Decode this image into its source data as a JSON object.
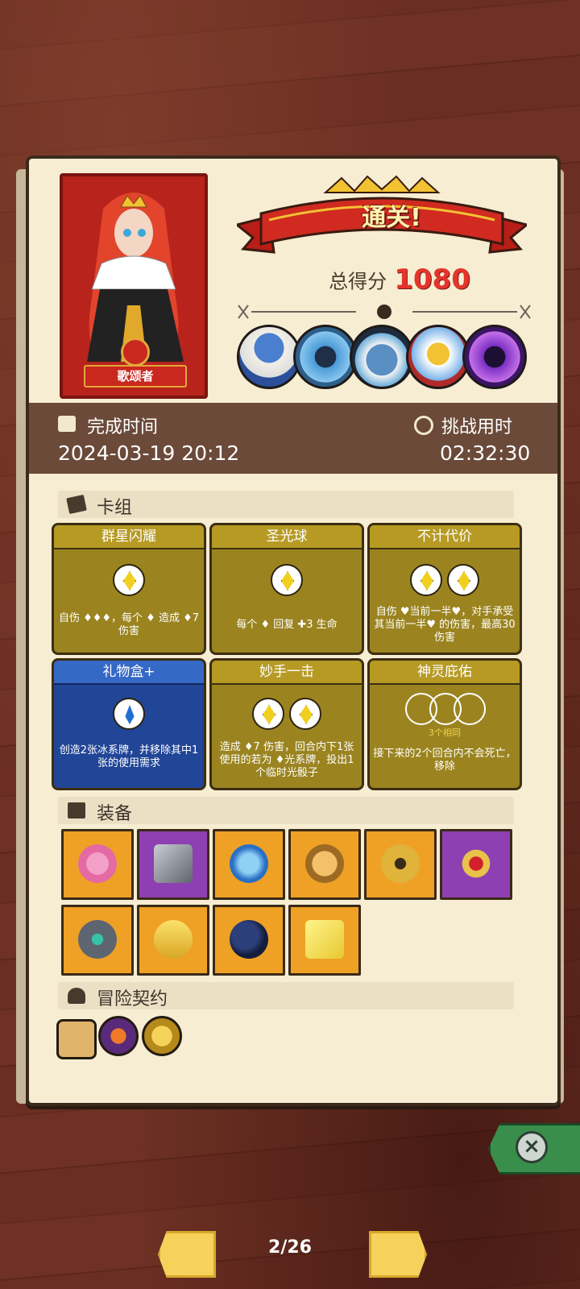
{
  "hero": {
    "name": "歌颂者"
  },
  "result": {
    "banner": "通关!",
    "score_label": "总得分",
    "score_value": "1080"
  },
  "bosses": [
    "mushroom-wizard-icon",
    "crab-king-icon",
    "fish-monster-icon",
    "armored-king-icon",
    "shadow-demon-icon"
  ],
  "times": {
    "complete_label": "完成时间",
    "complete_value": "2024-03-19 20:12",
    "challenge_label": "挑战用时",
    "challenge_value": "02:32:30"
  },
  "deck": {
    "heading": "卡组",
    "cards": [
      {
        "title": "群星闪耀",
        "color": "gold",
        "desc": "自伤 ♦♦♦，每个 ♦ 造成 ♦7 伤害"
      },
      {
        "title": "圣光球",
        "color": "gold",
        "desc": "每个 ♦ 回复 ✚3 生命"
      },
      {
        "title": "不计代价",
        "color": "gold",
        "desc": "自伤 ♥当前一半♥，对手承受其当前一半♥ 的伤害，最高30伤害"
      },
      {
        "title": "礼物盒+",
        "color": "blue",
        "desc": "创造2张冰系牌，并移除其中1张的使用需求"
      },
      {
        "title": "妙手一击",
        "color": "gold",
        "desc": "造成 ♦7 伤害，回合内下1张使用的若为 ♦光系牌，投出1个临时光骰子"
      },
      {
        "title": "神灵庇佑",
        "color": "gold",
        "sub": "3个相同",
        "desc": "接下来的2个回合内不会死亡，移除"
      }
    ]
  },
  "equipment": {
    "heading": "装备",
    "items": [
      {
        "icon": "lotus-flower-icon",
        "color": "orange"
      },
      {
        "icon": "stone-cube-icon",
        "color": "purple"
      },
      {
        "icon": "spiked-orb-icon",
        "color": "orange"
      },
      {
        "icon": "lion-ring-icon",
        "color": "orange"
      },
      {
        "icon": "golden-amulet-icon",
        "color": "orange"
      },
      {
        "icon": "ruby-ring-icon",
        "color": "purple"
      },
      {
        "icon": "rune-stone-icon",
        "color": "orange"
      },
      {
        "icon": "golden-crown-icon",
        "color": "orange"
      },
      {
        "icon": "plague-mask-icon",
        "color": "orange"
      },
      {
        "icon": "yellow-dice-icon",
        "color": "orange"
      }
    ]
  },
  "contract": {
    "heading": "冒险契约",
    "items": [
      "scroll-icon",
      "campfire-icon",
      "gold-coin-icon"
    ]
  },
  "pagination": {
    "label": "2/26"
  },
  "colors": {
    "gold_card": "#9b8420",
    "blue_card": "#214597",
    "score_red": "#e4352c",
    "equip_orange": "#eea125",
    "equip_purple": "#8e3fb1"
  }
}
